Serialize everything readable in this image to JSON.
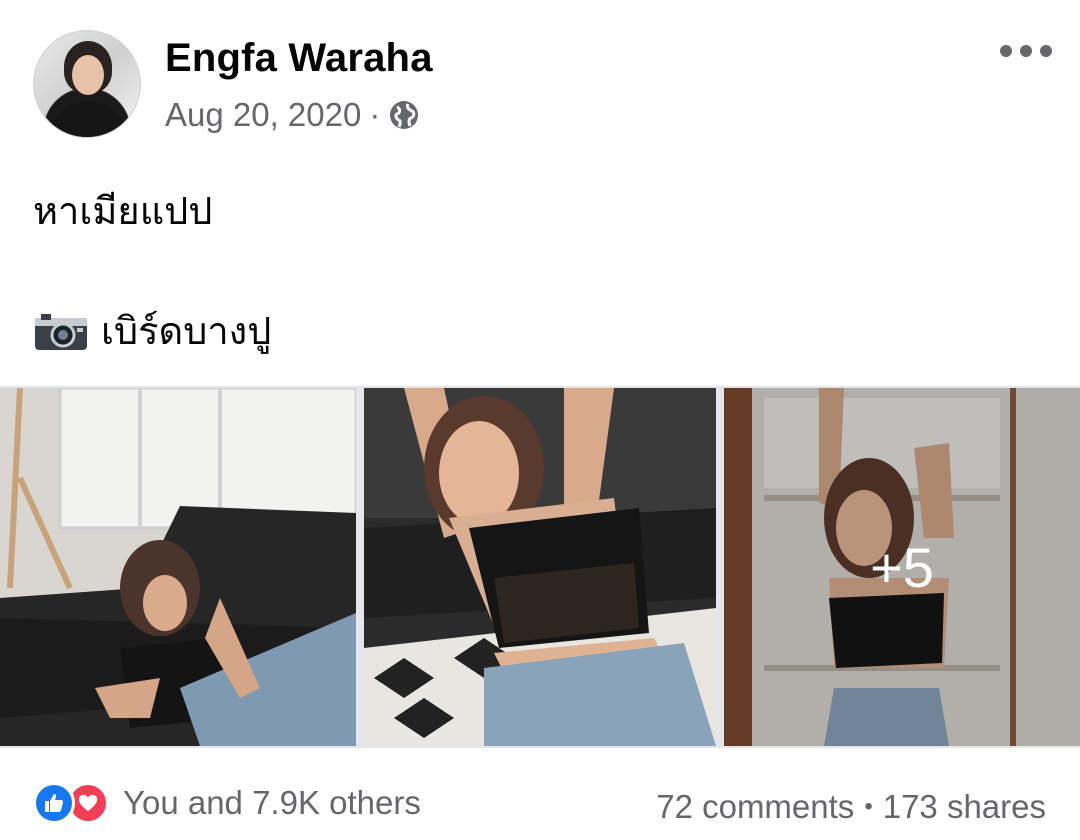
{
  "post": {
    "author": "Engfa Waraha",
    "date": "Aug 20, 2020",
    "separator": "·",
    "privacy_icon": "globe-icon",
    "menu_icon": "more-horizontal-icon",
    "text_line1": "หาเมียแปป",
    "text_line2": "เบิร์ดบางปู",
    "text_line2_icon": "camera-icon"
  },
  "photos": {
    "count_shown": 3,
    "more_label": "+5"
  },
  "footer": {
    "reactions_text": "You and 7.9K others",
    "comments": "72 comments",
    "stats_separator": "•",
    "shares": "173 shares",
    "reaction_icons": [
      "like-icon",
      "love-icon"
    ]
  },
  "colors": {
    "like_blue": "#1877f2",
    "love_red": "#f33e58",
    "secondary_text": "#65676b",
    "primary_text": "#050505"
  }
}
